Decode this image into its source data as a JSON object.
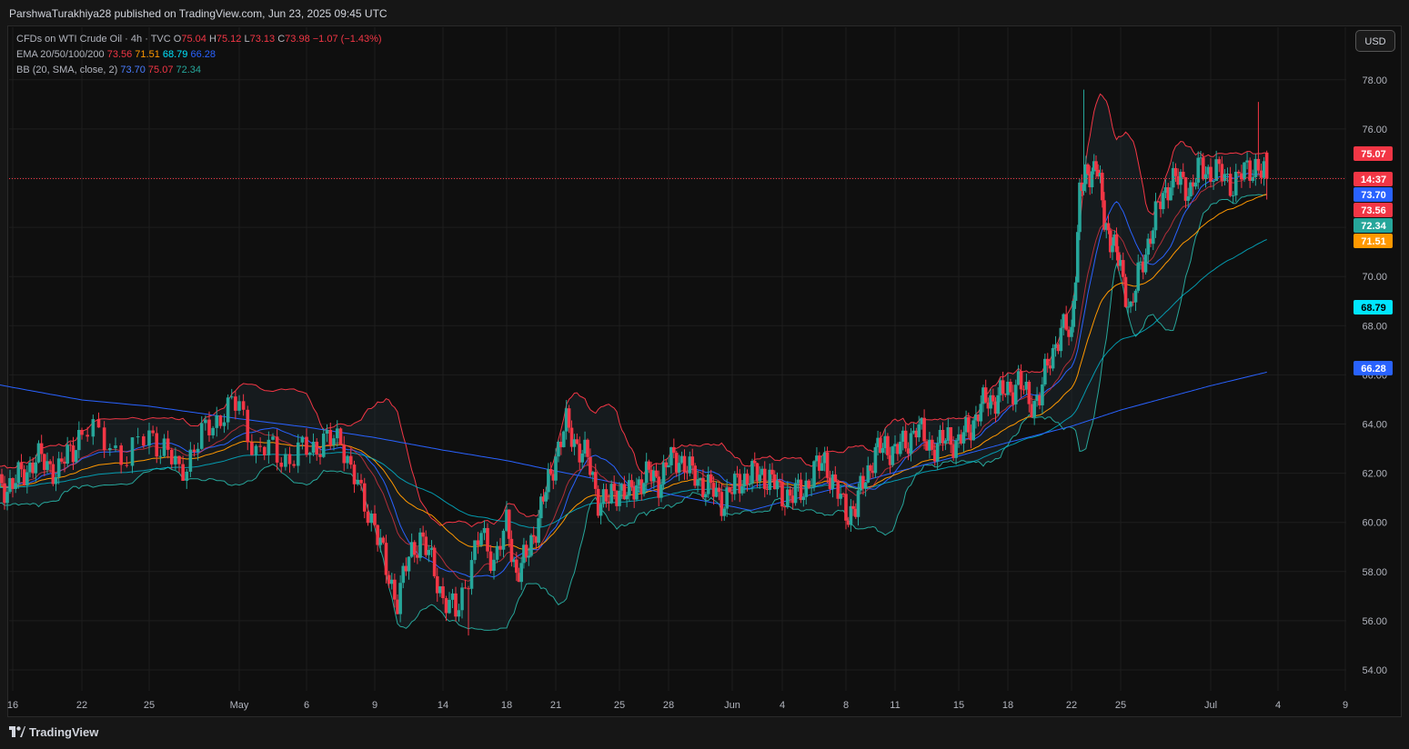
{
  "publisher": "ParshwaTurakhiya28 published on TradingView.com, Jun 23, 2025 09:45 UTC",
  "legend": {
    "symbol": "CFDs on WTI Crude Oil · 4h · TVC",
    "ohlc": {
      "o_label": "O",
      "o": "75.04",
      "h_label": "H",
      "h": "75.12",
      "l_label": "L",
      "l": "73.13",
      "c_label": "C",
      "c": "73.98",
      "change": "−1.07 (−1.43%)"
    },
    "ema": {
      "label": "EMA 20/50/100/200",
      "v20": "73.56",
      "v50": "71.51",
      "v100": "68.79",
      "v200": "66.28"
    },
    "bb": {
      "label": "BB (20, SMA, close, 2)",
      "basis": "73.70",
      "upper": "75.07",
      "lower": "72.34"
    }
  },
  "currency_button": "USD",
  "footer_brand": "TradingView",
  "colors": {
    "up": "#26a69a",
    "down": "#f23645",
    "ema20": "#f23645",
    "ema50": "#ff9800",
    "ema100": "#00bcd4",
    "ema200": "#2962ff",
    "bb_basis": "#2962ff",
    "bb_upper": "#f23645",
    "bb_lower": "#26a69a"
  },
  "chart_data": {
    "type": "candlestick",
    "title": "CFDs on WTI Crude Oil · 4h · TVC",
    "ylim": [
      53.5,
      79.5
    ],
    "y_ticks": [
      "54.00",
      "56.00",
      "58.00",
      "60.00",
      "62.00",
      "64.00",
      "66.00",
      "68.00",
      "70.00",
      "72.00",
      "74.00",
      "76.00",
      "78.00"
    ],
    "x_ticks": [
      "16",
      "22",
      "25",
      "May",
      "6",
      "9",
      "14",
      "18",
      "21",
      "25",
      "28",
      "Jun",
      "4",
      "8",
      "11",
      "15",
      "18",
      "22",
      "25",
      "Jul",
      "4",
      "9"
    ],
    "price_labels": [
      {
        "text": "75.07",
        "value": 75.07,
        "color": "#f23645"
      },
      {
        "text": "14:37",
        "value": 74.0,
        "color": "#f23645"
      },
      {
        "text": "73.70",
        "value": 73.7,
        "color": "#2962ff"
      },
      {
        "text": "73.56",
        "value": 73.56,
        "color": "#f23645"
      },
      {
        "text": "72.34",
        "value": 72.34,
        "color": "#26a69a"
      },
      {
        "text": "71.51",
        "value": 71.51,
        "color": "#ff9800"
      },
      {
        "text": "68.79",
        "value": 68.79,
        "color": "#00e5ff",
        "textColor": "#000000"
      },
      {
        "text": "66.28",
        "value": 66.28,
        "color": "#2962ff"
      }
    ],
    "current_price": 73.98,
    "series": {
      "close": [
        [
          16,
          61.5
        ],
        [
          18,
          62.6
        ],
        [
          20,
          62.1
        ],
        [
          22,
          63.7
        ],
        [
          23,
          63.4
        ],
        [
          24,
          62.6
        ],
        [
          25,
          63.6
        ],
        [
          26,
          63.0
        ],
        [
          27,
          62.0
        ],
        [
          28,
          63.0
        ],
        [
          29,
          63.9
        ],
        [
          30,
          64.5
        ],
        [
          31,
          64.8
        ],
        [
          32,
          62.8
        ],
        [
          33,
          63.0
        ],
        [
          34,
          62.5
        ],
        [
          35,
          63.0
        ],
        [
          36,
          63.2
        ],
        [
          37,
          63.3
        ],
        [
          37.5,
          63.6
        ],
        [
          38,
          62.5
        ],
        [
          39,
          61.0
        ],
        [
          40,
          60.0
        ],
        [
          41,
          58.0
        ],
        [
          42,
          56.9
        ],
        [
          43,
          58.5
        ],
        [
          44,
          59.5
        ],
        [
          45,
          58.3
        ],
        [
          46,
          57.0
        ],
        [
          47,
          56.2
        ],
        [
          48,
          58.0
        ],
        [
          49,
          59.5
        ],
        [
          50,
          58.5
        ],
        [
          51,
          59.8
        ],
        [
          52,
          58.0
        ],
        [
          53,
          58.5
        ],
        [
          54,
          59.9
        ],
        [
          55,
          61.2
        ],
        [
          56,
          62.8
        ],
        [
          57,
          63.9
        ],
        [
          58,
          63.2
        ],
        [
          59,
          62.5
        ],
        [
          60,
          61.0
        ],
        [
          61,
          60.8
        ],
        [
          62,
          61.5
        ],
        [
          63,
          61.0
        ],
        [
          64,
          61.7
        ],
        [
          65,
          61.9
        ],
        [
          66,
          61.7
        ],
        [
          67,
          62.4
        ],
        [
          68,
          62.7
        ],
        [
          69,
          62.0
        ],
        [
          70,
          61.7
        ],
        [
          71,
          61.3
        ],
        [
          72,
          60.9
        ],
        [
          73,
          61.3
        ],
        [
          74,
          61.8
        ],
        [
          75,
          61.9
        ],
        [
          76,
          62.0
        ],
        [
          77,
          61.6
        ],
        [
          78,
          61.2
        ],
        [
          79,
          61.0
        ],
        [
          80,
          61.4
        ],
        [
          81,
          62.0
        ],
        [
          82,
          62.6
        ],
        [
          83,
          61.3
        ],
        [
          84,
          60.5
        ],
        [
          85,
          60.5
        ],
        [
          86,
          62.0
        ],
        [
          87,
          62.7
        ],
        [
          88,
          63.2
        ],
        [
          89,
          62.8
        ],
        [
          90,
          63.3
        ],
        [
          91,
          63.8
        ],
        [
          92,
          63.3
        ],
        [
          93,
          63.0
        ],
        [
          94,
          63.5
        ],
        [
          95,
          63.2
        ],
        [
          96,
          63.8
        ],
        [
          97,
          64.5
        ],
        [
          98,
          65.0
        ],
        [
          99,
          65.1
        ],
        [
          100,
          65.3
        ],
        [
          101,
          65.8
        ],
        [
          102,
          64.8
        ],
        [
          103,
          65.2
        ],
        [
          104,
          66.6
        ],
        [
          105,
          68.0
        ],
        [
          106,
          67.5
        ],
        [
          107,
          73.5
        ],
        [
          108,
          74.0
        ],
        [
          109,
          74.8
        ],
        [
          110,
          72.2
        ],
        [
          111,
          71.5
        ],
        [
          112,
          70.2
        ],
        [
          113,
          68.7
        ],
        [
          114,
          70.3
        ],
        [
          115,
          71.8
        ],
        [
          116,
          73.0
        ],
        [
          117,
          74.0
        ],
        [
          118,
          73.8
        ],
        [
          119,
          73.6
        ],
        [
          120,
          74.4
        ],
        [
          121,
          74.3
        ],
        [
          122,
          74.1
        ],
        [
          123,
          73.8
        ],
        [
          124,
          74.2
        ],
        [
          125,
          74.6
        ],
        [
          126,
          73.98
        ]
      ]
    }
  }
}
